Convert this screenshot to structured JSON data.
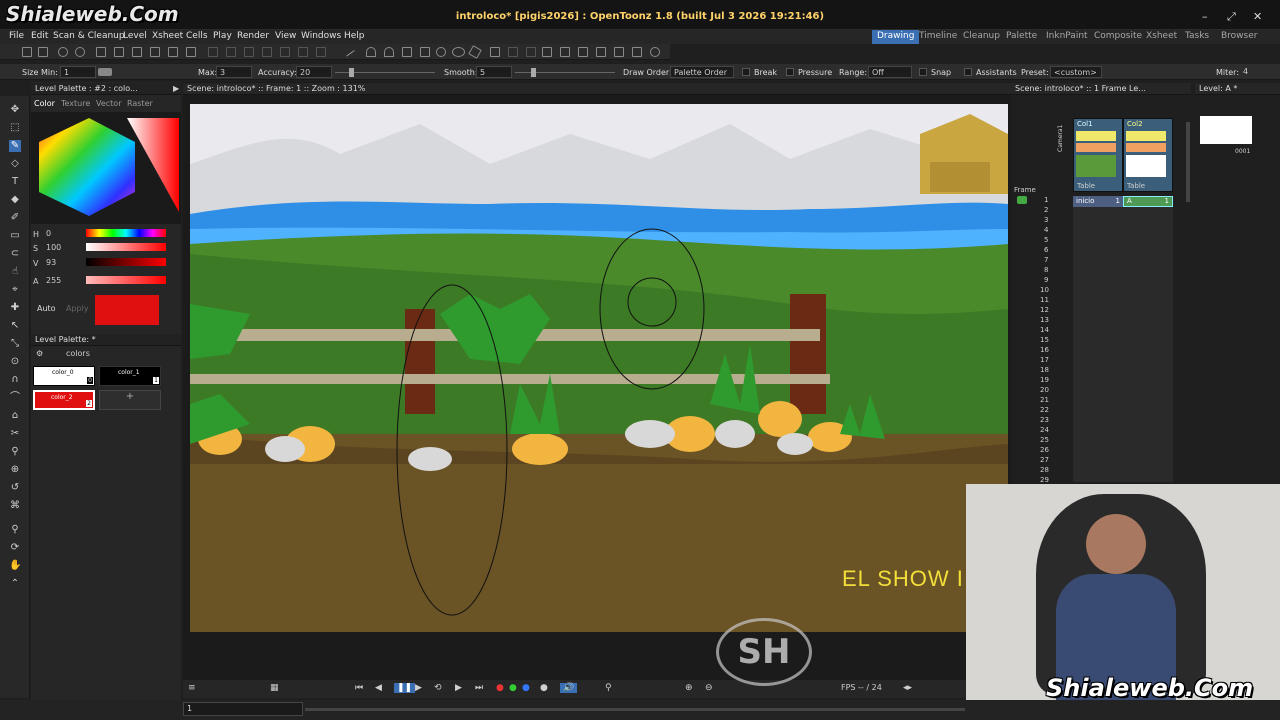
{
  "watermark": {
    "brand": "Shialeweb.Com",
    "overlay": "EL SHOW I",
    "logo": "SH"
  },
  "window": {
    "title": "introloco* [pigis2026] : OpenToonz 1.8 (built Jul 3 2026 19:21:46)",
    "minimize": "–",
    "maximize": "⤢",
    "close": "✕"
  },
  "menu": [
    "File",
    "Edit",
    "Scan & Cleanup",
    "Level",
    "Xsheet",
    "Cells",
    "Play",
    "Render",
    "View",
    "Windows",
    "Help"
  ],
  "rooms": [
    "Drawing",
    "Timeline",
    "Cleanup",
    "Palette",
    "InknPaint",
    "Composite",
    "Xsheet",
    "Tasks",
    "Browser"
  ],
  "options": {
    "size_min_label": "Size Min:",
    "size_min": "1",
    "max_label": "Max:",
    "max": "3",
    "accuracy_label": "Accuracy:",
    "accuracy": "20",
    "smooth_label": "Smooth:",
    "smooth": "5",
    "draw_order_label": "Draw Order:",
    "draw_order": "Palette Order",
    "break": "Break",
    "pressure": "Pressure",
    "range_label": "Range:",
    "range": "Off",
    "snap": "Snap",
    "assistants": "Assistants",
    "preset_label": "Preset:",
    "preset": "<custom>",
    "miter_label": "Miter:",
    "miter": "4"
  },
  "level_palette": {
    "header": "Level Palette : #2 : colo...",
    "tabs": [
      "Color",
      "Texture",
      "Vector",
      "Raster"
    ],
    "h": "0",
    "s": "100",
    "v": "93",
    "a": "255",
    "auto": "Auto",
    "apply": "Apply",
    "accent": "#e01010",
    "header2": "Level Palette: *",
    "folder": "colors",
    "styles": [
      {
        "name": "color_0",
        "index": "0"
      },
      {
        "name": "color_1",
        "index": "1"
      },
      {
        "name": "color_2",
        "index": "2"
      }
    ],
    "add": "+"
  },
  "viewer": {
    "header": "Scene: introloco*  ::  Frame: 1  ::  Zoom : 131%",
    "fps": "FPS -- / 24",
    "frame_field": "1"
  },
  "xsheet": {
    "header": "Scene: introloco*    ::    1 Frame Le...",
    "frame_label": "Frame",
    "camera": "Camera1",
    "col1": "Col1",
    "col2": "Col2",
    "col1_name": "Table",
    "col2_name": "Table",
    "cell1": "inicio",
    "cell1_num": "1",
    "cell2": "A",
    "cell2_num": "1",
    "rows": [
      "1",
      "2",
      "3",
      "4",
      "5",
      "6",
      "7",
      "8",
      "9",
      "10",
      "11",
      "12",
      "13",
      "14",
      "15",
      "16",
      "17",
      "18",
      "19",
      "20",
      "21",
      "22",
      "23",
      "24",
      "25",
      "26",
      "27",
      "28",
      "29"
    ]
  },
  "levelstrip": {
    "header": "Level: A *",
    "frame": "0001"
  }
}
